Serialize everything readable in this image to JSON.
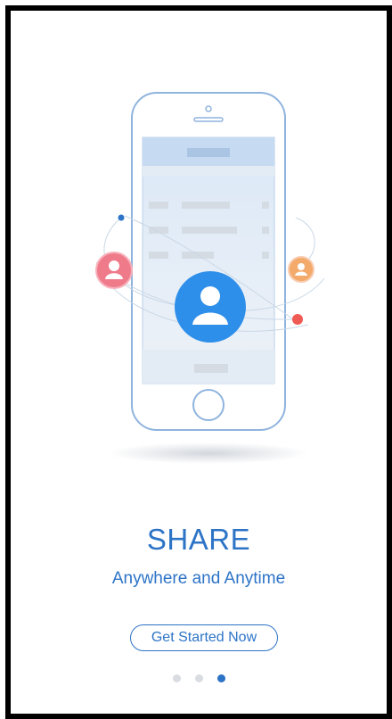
{
  "onboarding": {
    "title": "SHARE",
    "subtitle": "Anywhere and Anytime",
    "cta_label": "Get Started Now",
    "pages": [
      {
        "active": false
      },
      {
        "active": false
      },
      {
        "active": true
      }
    ],
    "colors": {
      "accent": "#2d74c7",
      "avatar_left": "#ef7a8a",
      "avatar_right": "#f3aa6b",
      "avatar_center": "#2e8fea",
      "dot_inactive": "#d9dce1",
      "dot_active": "#2d74c7"
    },
    "illustration": {
      "main_avatar": "user-icon",
      "left_avatar": "user-icon",
      "right_avatar": "user-icon"
    }
  }
}
